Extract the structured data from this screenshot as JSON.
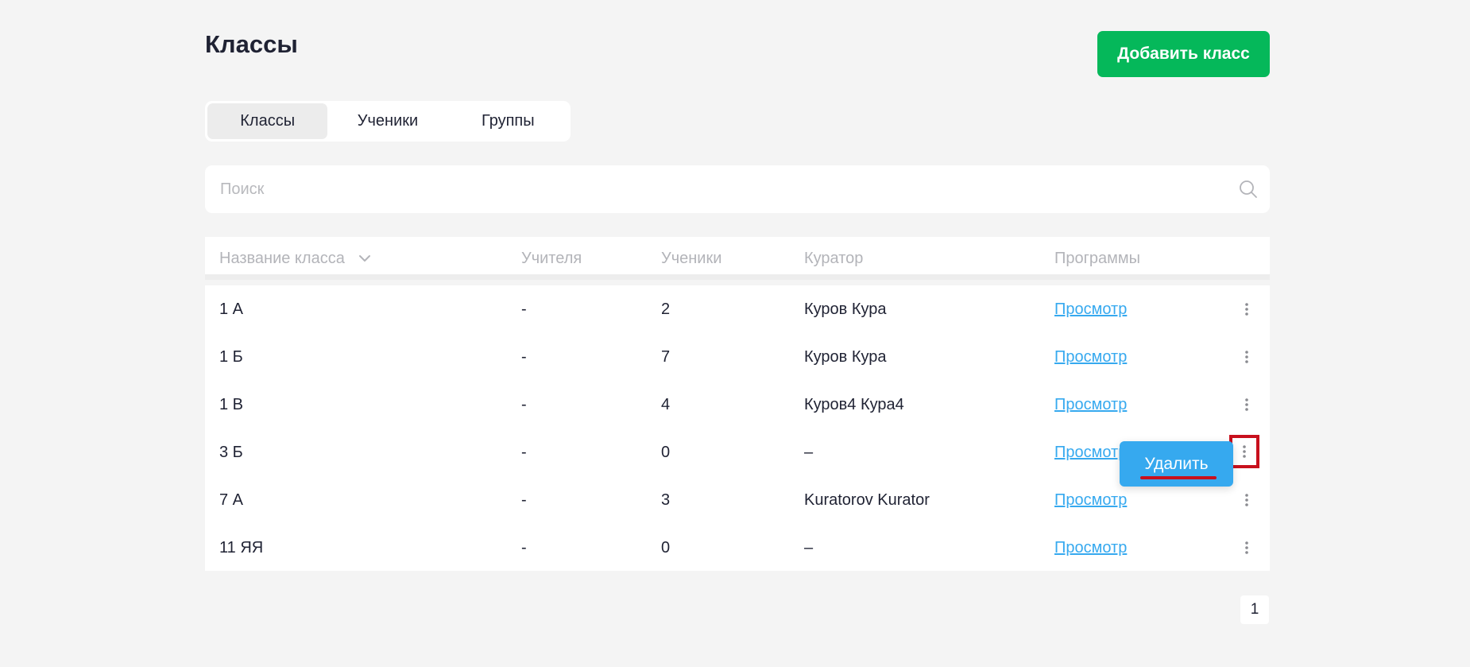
{
  "header": {
    "title": "Классы",
    "add_button_label": "Добавить класс"
  },
  "tabs": [
    {
      "label": "Классы",
      "active": true
    },
    {
      "label": "Ученики",
      "active": false
    },
    {
      "label": "Группы",
      "active": false
    }
  ],
  "search": {
    "placeholder": "Поиск",
    "value": "",
    "icon": "search-icon"
  },
  "table": {
    "columns": [
      "Название класса",
      "Учителя",
      "Ученики",
      "Куратор",
      "Программы"
    ],
    "sort_icon": "chevron-down-icon",
    "rows": [
      {
        "name": "1 А",
        "teachers": "-",
        "students": "2",
        "curator": "Куров Кура",
        "programs": "Просмотр"
      },
      {
        "name": "1 Б",
        "teachers": "-",
        "students": "7",
        "curator": "Куров Кура",
        "programs": "Просмотр"
      },
      {
        "name": "1 В",
        "teachers": "-",
        "students": "4",
        "curator": "Куров4 Кура4",
        "programs": "Просмотр"
      },
      {
        "name": "3 Б",
        "teachers": "-",
        "students": "0",
        "curator": "–",
        "programs": "Просмотр"
      },
      {
        "name": "7 А",
        "teachers": "-",
        "students": "3",
        "curator": "Kuratorov Kurator",
        "programs": "Просмотр"
      },
      {
        "name": "11 ЯЯ",
        "teachers": "-",
        "students": "0",
        "curator": "–",
        "programs": "Просмотр"
      }
    ]
  },
  "context_menu": {
    "delete_label": "Удалить"
  },
  "pagination": {
    "current_page": "1"
  },
  "colors": {
    "accent_green": "#05b85a",
    "link_blue": "#36a9ef",
    "highlight_red": "#c8101d"
  }
}
